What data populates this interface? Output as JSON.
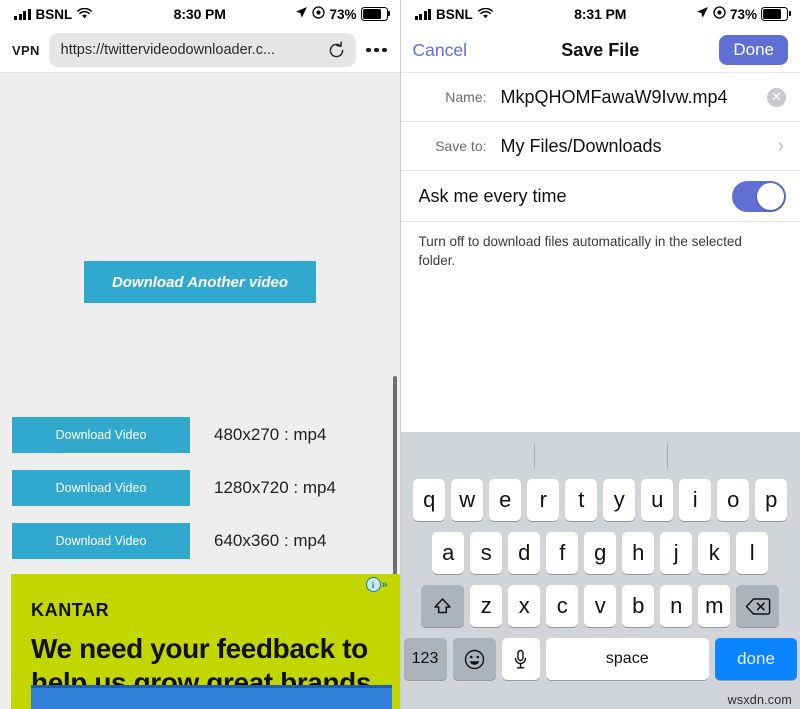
{
  "left_panel": {
    "status_bar": {
      "carrier": "BSNL",
      "wifi_icon": "wifi-icon",
      "time": "8:30 PM",
      "location_icon": "location-arrow-icon",
      "alarm_icon": "alarm-icon",
      "battery_percent": "73%"
    },
    "browser": {
      "vpn_label": "VPN",
      "url": "https://twittervideodownloader.c...",
      "reload_icon": "reload-icon",
      "more_icon": "more-options-icon"
    },
    "page": {
      "another_video_button": "Download Another video",
      "downloads": [
        {
          "button": "Download Video",
          "resolution": "480x270 : mp4"
        },
        {
          "button": "Download Video",
          "resolution": "1280x720 : mp4"
        },
        {
          "button": "Download Video",
          "resolution": "640x360 : mp4"
        }
      ],
      "ad": {
        "brand": "KANTAR",
        "headline": "We need your feedback to help us grow great brands.",
        "adchoices_icon": "adchoices-info-icon",
        "adchoices_arrow": "»",
        "background_color": "#c4d600",
        "cta_color": "#2f7fd6"
      }
    }
  },
  "right_panel": {
    "status_bar": {
      "carrier": "BSNL",
      "wifi_icon": "wifi-icon",
      "time": "8:31 PM",
      "location_icon": "location-arrow-icon",
      "alarm_icon": "alarm-icon",
      "battery_percent": "73%"
    },
    "nav": {
      "cancel": "Cancel",
      "title": "Save File",
      "done": "Done",
      "done_color": "#5f6fd4",
      "cancel_color": "#5f6fd4"
    },
    "form": {
      "name_label": "Name:",
      "name_value": "MkpQHOMFawaW9Ivw.mp4",
      "name_clear_icon": "clear-field-icon",
      "saveto_label": "Save to:",
      "saveto_value": "My Files/Downloads",
      "saveto_chevron_icon": "chevron-right-icon",
      "toggle_label": "Ask me every time",
      "toggle_on": true,
      "toggle_color": "#5f6fd4",
      "hint": "Turn off to download files automatically in the selected folder."
    },
    "keyboard": {
      "row1": [
        "q",
        "w",
        "e",
        "r",
        "t",
        "y",
        "u",
        "i",
        "o",
        "p"
      ],
      "row2": [
        "a",
        "s",
        "d",
        "f",
        "g",
        "h",
        "j",
        "k",
        "l"
      ],
      "row3": [
        "z",
        "x",
        "c",
        "v",
        "b",
        "n",
        "m"
      ],
      "shift_icon": "shift-arrow-icon",
      "backspace_icon": "backspace-icon",
      "numbers_key": "123",
      "emoji_icon": "emoji-smiley-icon",
      "mic_icon": "microphone-icon",
      "space_key": "space",
      "done_key": "done",
      "done_key_color": "#0a84ff"
    }
  },
  "watermark": "wsxdn.com"
}
